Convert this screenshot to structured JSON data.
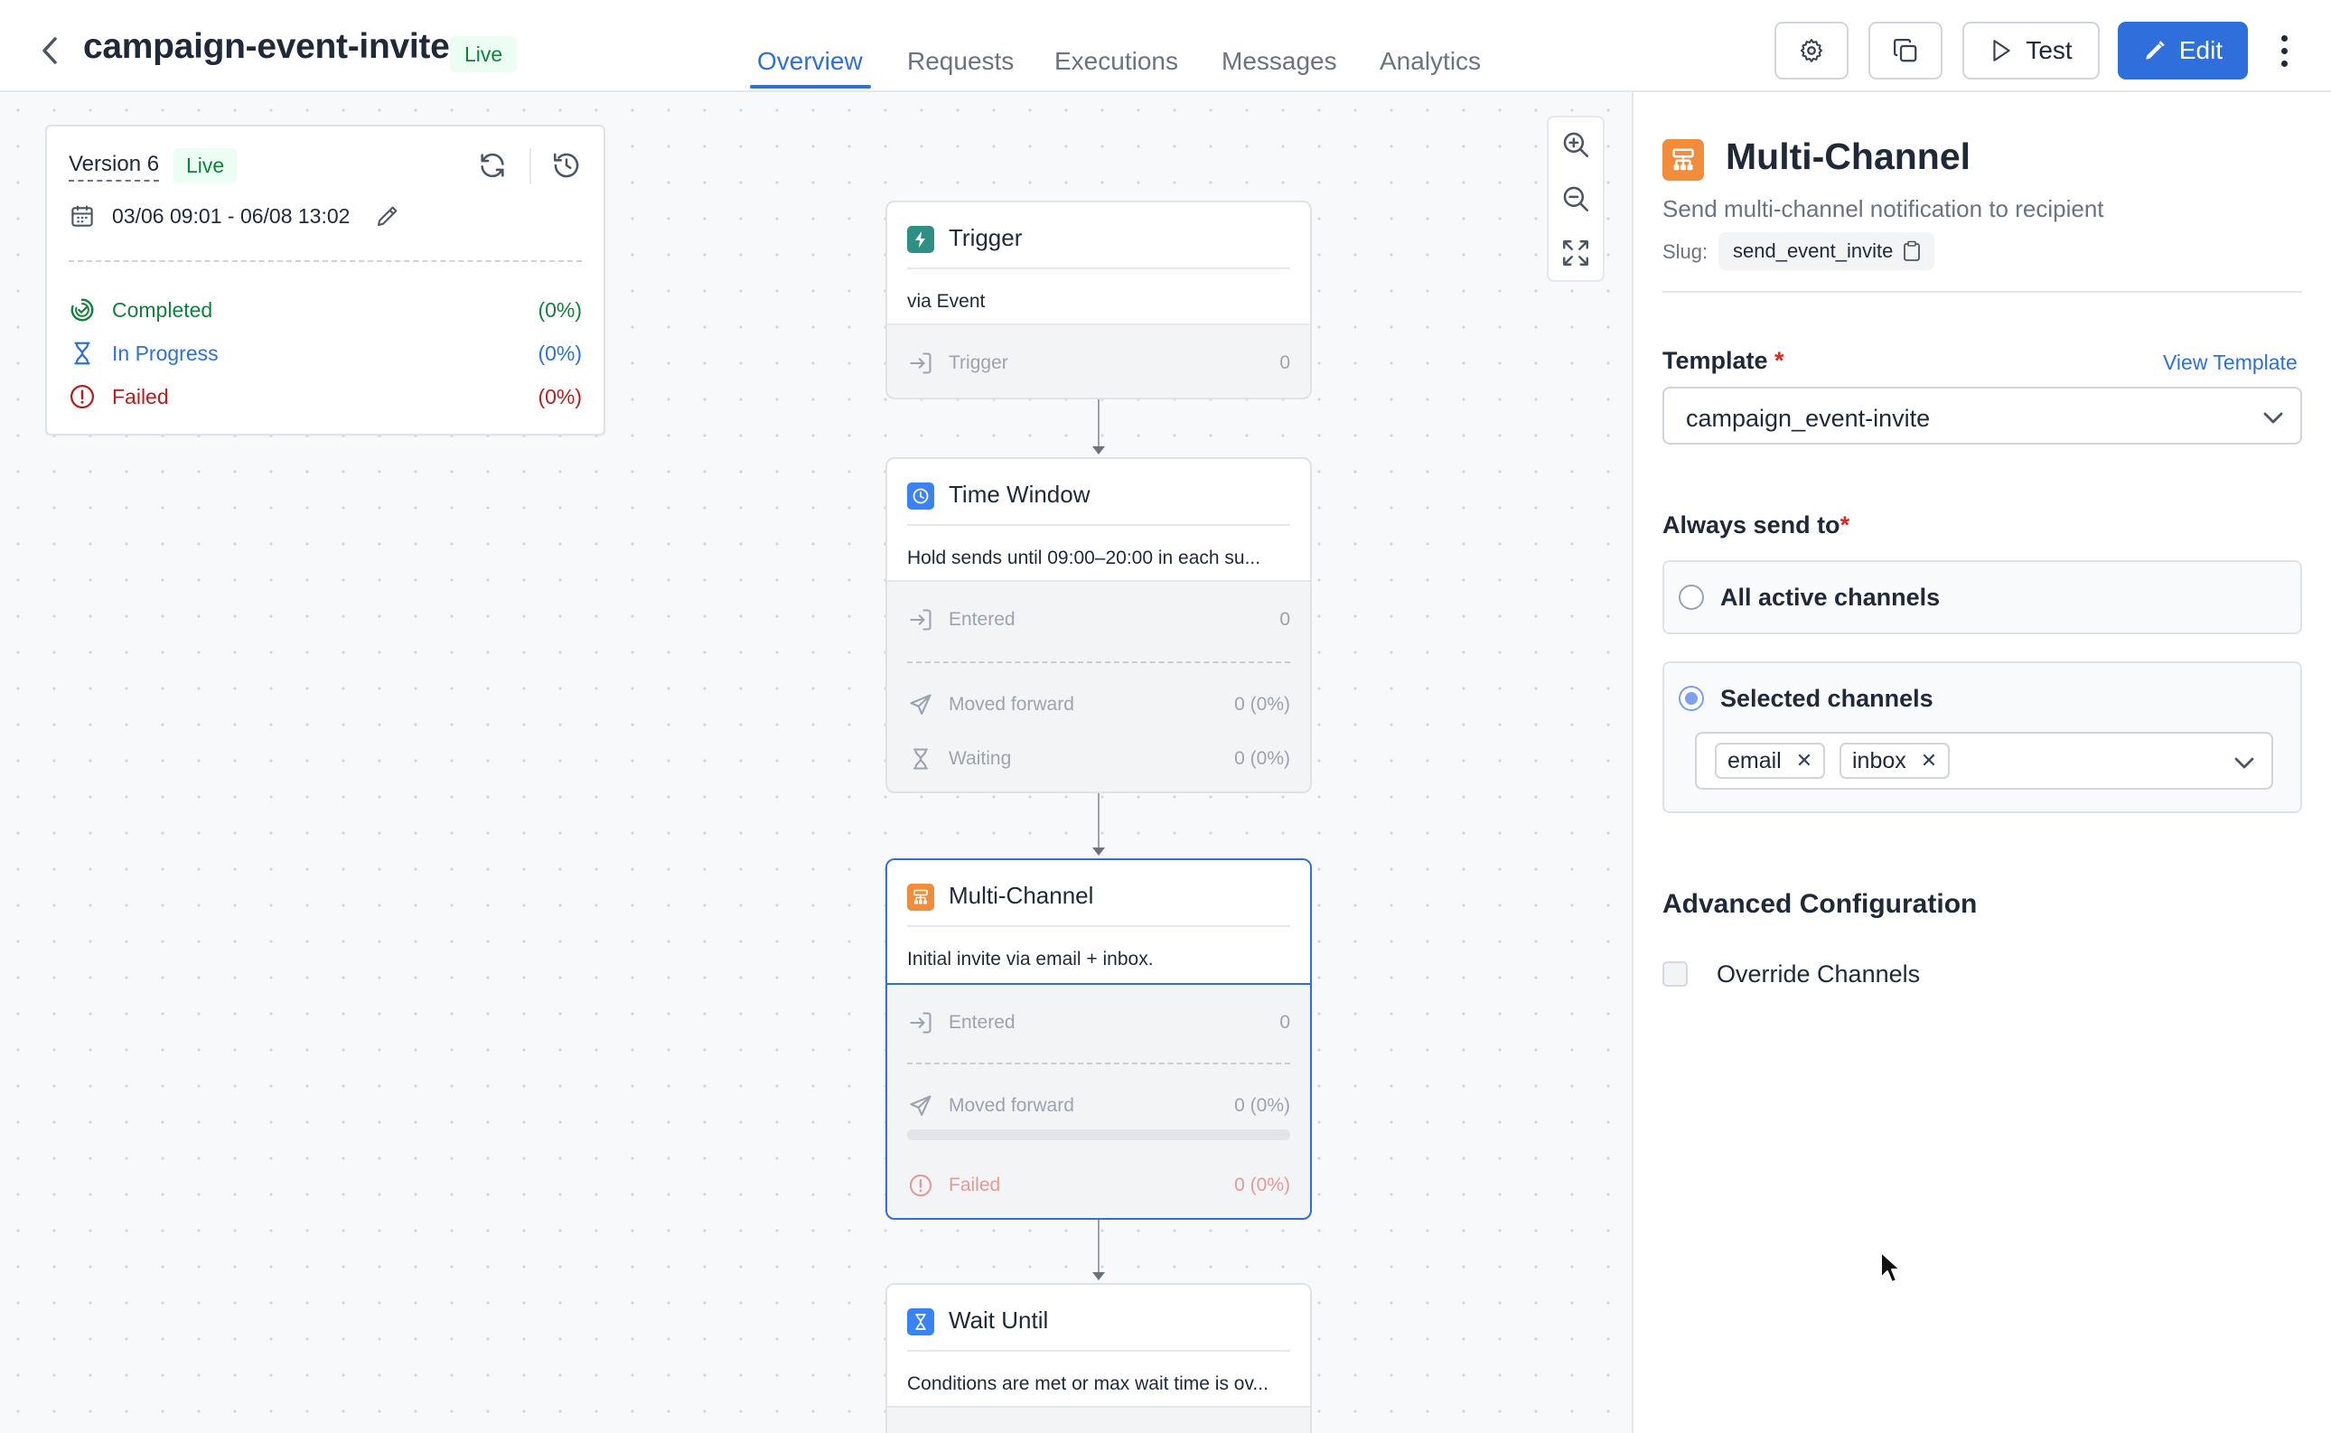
{
  "header": {
    "title": "campaign-event-invite",
    "status": "Live",
    "tabs": [
      {
        "label": "Overview",
        "active": true
      },
      {
        "label": "Requests",
        "active": false
      },
      {
        "label": "Executions",
        "active": false
      },
      {
        "label": "Messages",
        "active": false
      },
      {
        "label": "Analytics",
        "active": false
      }
    ],
    "buttons": {
      "test": "Test",
      "edit": "Edit"
    },
    "accent": "#2f6fdb"
  },
  "version_card": {
    "version": "Version 6",
    "status": "Live",
    "date_range": "03/06 09:01 - 06/08 13:02",
    "stats": [
      {
        "label": "Completed",
        "value": "(0%)",
        "color": "#15803d",
        "icon": "check-progress-icon"
      },
      {
        "label": "In Progress",
        "value": "(0%)",
        "color": "#2f6fdb",
        "icon": "hourglass-icon"
      },
      {
        "label": "Failed",
        "value": "(0%)",
        "color": "#b91c1c",
        "icon": "alert-circle-icon"
      }
    ]
  },
  "nodes": {
    "trigger": {
      "title": "Trigger",
      "desc": "via Event",
      "metrics": [
        {
          "label": "Trigger",
          "value": "0"
        }
      ]
    },
    "time_window": {
      "title": "Time Window",
      "desc": "Hold sends until 09:00–20:00 in each su...",
      "metrics": [
        {
          "label": "Entered",
          "value": "0"
        },
        {
          "label": "Moved forward",
          "value": "0 (0%)"
        },
        {
          "label": "Waiting",
          "value": "0 (0%)"
        }
      ]
    },
    "multi_channel": {
      "title": "Multi-Channel",
      "desc": "Initial invite via email + inbox.",
      "progress": 0,
      "metrics": [
        {
          "label": "Entered",
          "value": "0"
        },
        {
          "label": "Moved forward",
          "value": "0 (0%)"
        },
        {
          "label": "Failed",
          "value": "0 (0%)"
        }
      ]
    },
    "wait_until": {
      "title": "Wait Until",
      "desc": "Conditions are met or max wait time is ov..."
    }
  },
  "panel": {
    "title": "Multi-Channel",
    "description": "Send multi-channel notification to recipient",
    "slug_label": "Slug:",
    "slug": "send_event_invite",
    "template_label": "Template",
    "view_template": "View Template",
    "template_value": "campaign_event-invite",
    "send_label": "Always send to",
    "options": {
      "all": "All active channels",
      "selected": "Selected channels"
    },
    "selected_option": "selected",
    "channels": [
      "email",
      "inbox"
    ],
    "advanced_title": "Advanced Configuration",
    "override_label": "Override Channels",
    "override_checked": false,
    "required_marker": "*"
  }
}
